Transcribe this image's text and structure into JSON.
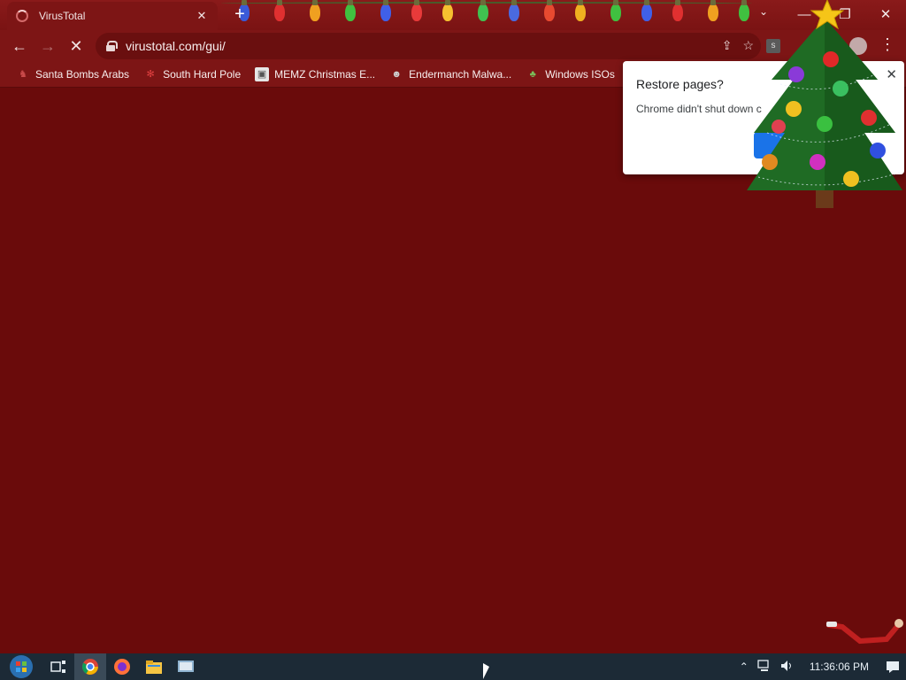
{
  "tab": {
    "title": "VirusTotal",
    "close": "✕"
  },
  "toolbar": {
    "back": "←",
    "forward": "→",
    "reload": "✕",
    "url": "virustotal.com/gui/",
    "share": "⇪",
    "star": "☆",
    "ext_label": "s",
    "menu": "⋮"
  },
  "window_controls": {
    "tab_search": "⌄",
    "minimize": "—",
    "restore": "❐",
    "close": "✕"
  },
  "bookmarks": [
    {
      "label": "Santa Bombs Arabs",
      "icon": "santa-icon",
      "color": "#c94a4a"
    },
    {
      "label": "South Hard Pole",
      "icon": "snowflake-icon",
      "color": "#d23a3a"
    },
    {
      "label": "MEMZ Christmas E...",
      "icon": "memz-icon",
      "color": "#e6e6e6"
    },
    {
      "label": "Endermanch Malwa...",
      "icon": "endermanch-icon",
      "color": "#b0b0b0"
    },
    {
      "label": "Windows ISOs",
      "icon": "tree-bookmark-icon",
      "color": "#6aa84f"
    }
  ],
  "popup": {
    "title": "Restore pages?",
    "body": "Chrome didn't shut down c",
    "close": "✕"
  },
  "taskbar": {
    "items": [
      "start-orb-icon",
      "task-view-icon",
      "chrome-icon",
      "firefox-icon",
      "file-explorer-icon",
      "app-icon"
    ],
    "clock": "11:36:06 PM",
    "tray_up": "⌃",
    "notifications": "▭"
  },
  "colors": {
    "page": "#6a0b0b",
    "chrome_frame": "#7d1515",
    "taskbar": "#1c2a36",
    "accent": "#1a73e8"
  }
}
